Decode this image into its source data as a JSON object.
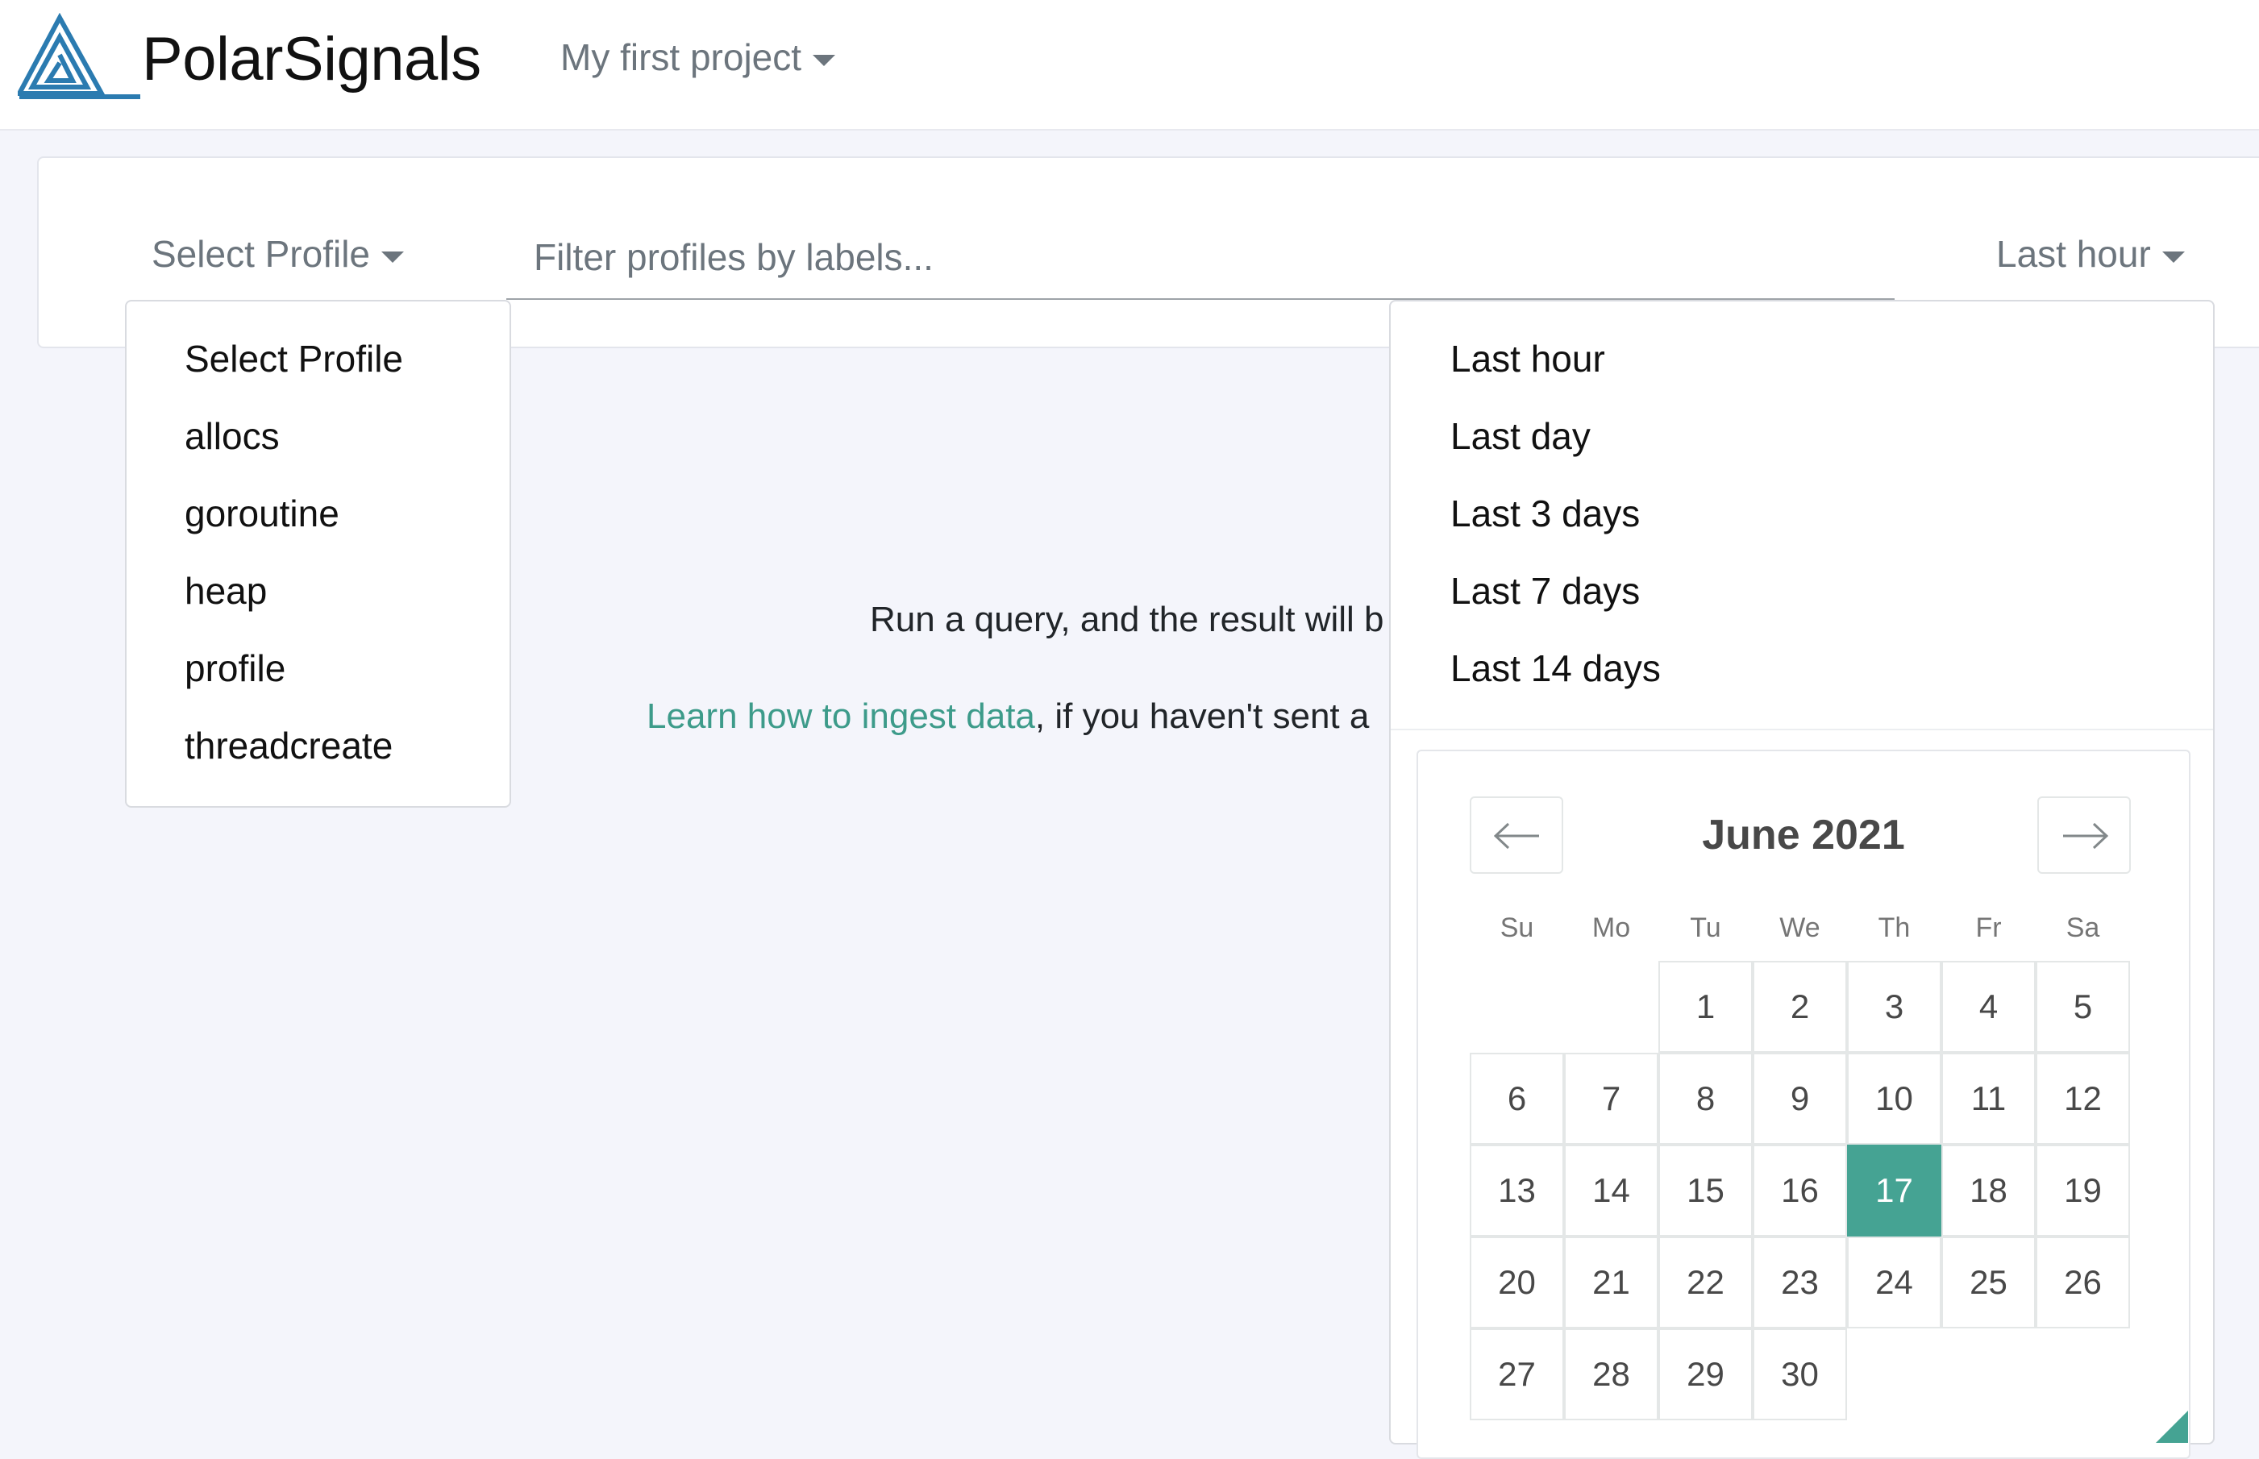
{
  "navbar": {
    "brand": "PolarSignals",
    "project": "My first project"
  },
  "toolbar": {
    "profile_toggle": "Select Profile",
    "filter_placeholder": "Filter profiles by labels...",
    "time_toggle": "Last hour"
  },
  "profile_menu": {
    "items": [
      "Select Profile",
      "allocs",
      "goroutine",
      "heap",
      "profile",
      "threadcreate"
    ]
  },
  "time_menu": {
    "items": [
      "Last hour",
      "Last day",
      "Last 3 days",
      "Last 7 days",
      "Last 14 days"
    ]
  },
  "empty_state": {
    "line1": "Run a query, and the result will b",
    "link": "Learn how to ingest data",
    "line2_rest": ", if you haven't sent a"
  },
  "calendar": {
    "month_title": "June 2021",
    "weekdays": [
      "Su",
      "Mo",
      "Tu",
      "We",
      "Th",
      "Fr",
      "Sa"
    ],
    "days": [
      "1",
      "2",
      "3",
      "4",
      "5",
      "6",
      "7",
      "8",
      "9",
      "10",
      "11",
      "12",
      "13",
      "14",
      "15",
      "16",
      "17",
      "18",
      "19",
      "20",
      "21",
      "22",
      "23",
      "24",
      "25",
      "26",
      "27",
      "28",
      "29",
      "30"
    ],
    "selected_day": "17",
    "accent_color": "#45a393",
    "prev_icon": "arrow-left-icon",
    "next_icon": "arrow-right-icon"
  },
  "colors": {
    "link": "#3d9b8a",
    "brand_logo": "#2b7bb0",
    "page_bg": "#f4f5fb"
  }
}
